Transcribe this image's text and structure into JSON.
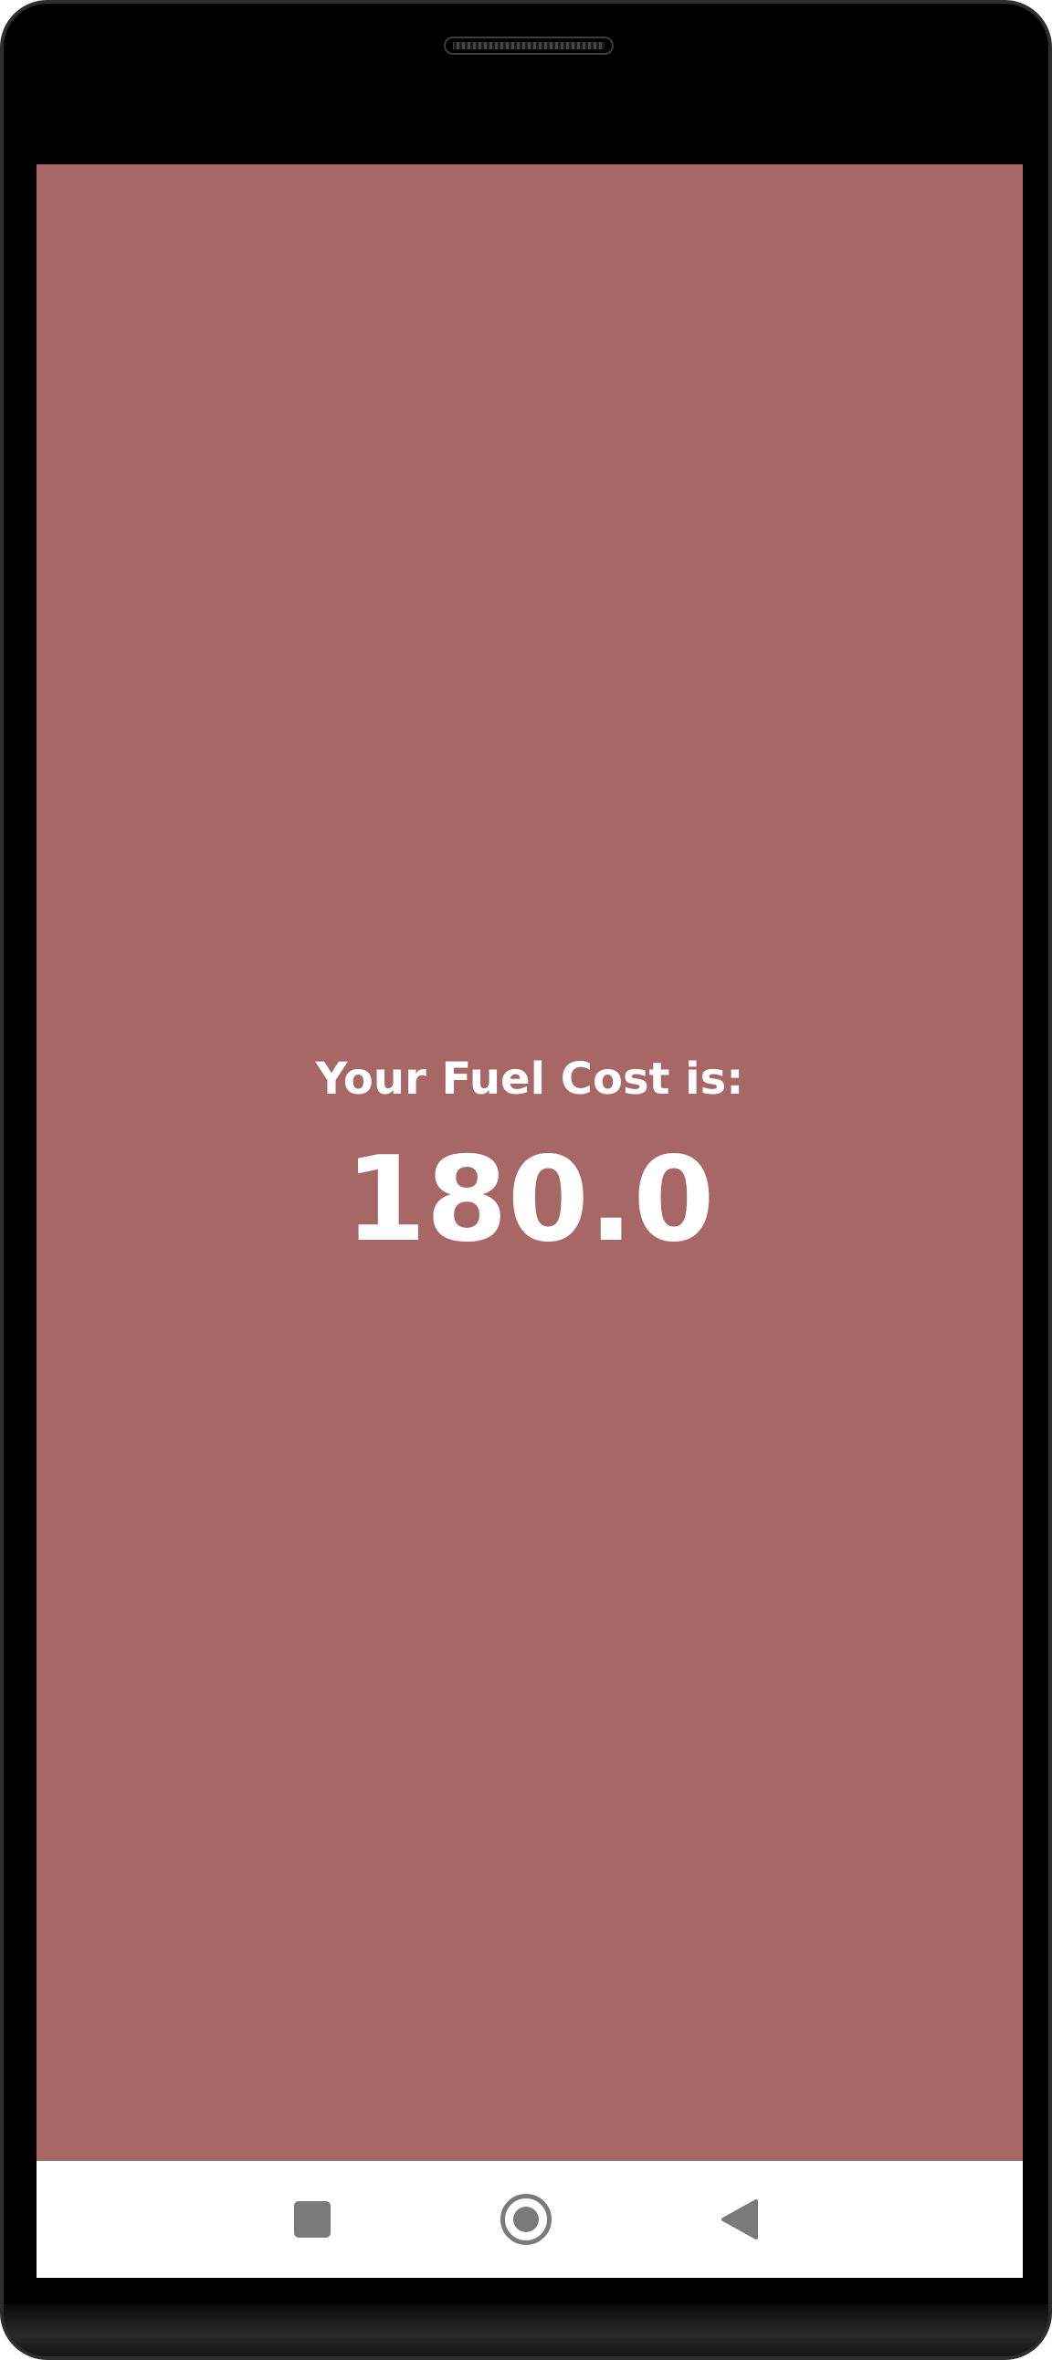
{
  "app": {
    "result_label": "Your Fuel Cost is:",
    "result_value": "180.0"
  },
  "nav_bar": {
    "recents_icon": "square-recents-icon",
    "home_icon": "circle-home-icon",
    "back_icon": "triangle-back-icon"
  },
  "colors": {
    "app_background": "#a86767",
    "text": "#ffffff",
    "nav_background": "#ffffff",
    "nav_icons": "#7a7a7a",
    "device_frame": "#000000"
  }
}
